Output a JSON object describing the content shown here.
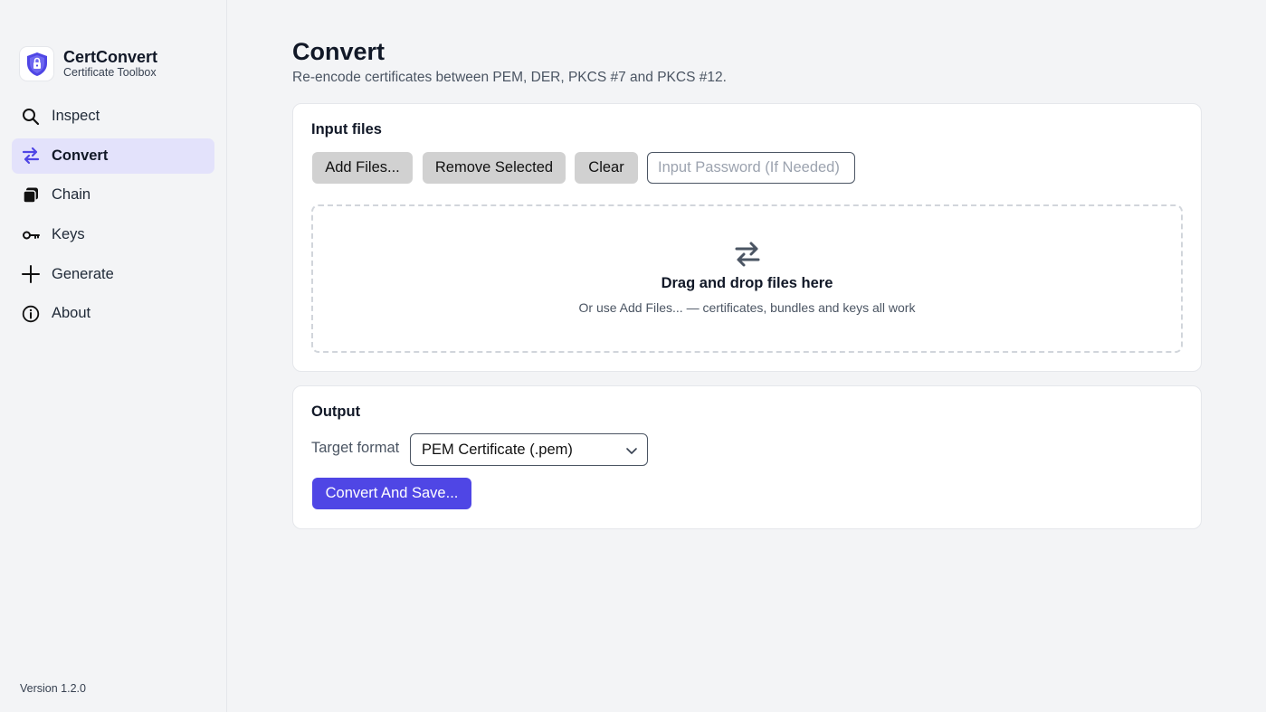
{
  "brand": {
    "name": "CertConvert",
    "subtitle": "Certificate Toolbox"
  },
  "sidebar": {
    "items": [
      {
        "label": "Inspect",
        "icon": "search-icon",
        "active": false
      },
      {
        "label": "Convert",
        "icon": "swap-arrows-icon",
        "active": true
      },
      {
        "label": "Chain",
        "icon": "stack-icon",
        "active": false
      },
      {
        "label": "Keys",
        "icon": "key-icon",
        "active": false
      },
      {
        "label": "Generate",
        "icon": "plus-icon",
        "active": false
      },
      {
        "label": "About",
        "icon": "info-icon",
        "active": false
      }
    ],
    "version": "Version 1.2.0"
  },
  "page": {
    "title": "Convert",
    "subtitle": "Re-encode certificates between PEM, DER, PKCS #7 and PKCS #12."
  },
  "input_card": {
    "title": "Input files",
    "buttons": {
      "add": "Add Files...",
      "remove": "Remove Selected",
      "clear": "Clear"
    },
    "password_placeholder": "Input Password (If Needed)",
    "dropzone": {
      "icon": "swap-arrows-icon",
      "title": "Drag and drop files here",
      "subtitle": "Or use Add Files... — certificates, bundles and keys all work"
    }
  },
  "output_card": {
    "title": "Output",
    "target_label": "Target format",
    "target_value": "PEM Certificate (.pem)",
    "convert_button": "Convert And Save..."
  },
  "colors": {
    "accent": "#4f46e5",
    "active_nav_bg": "#e3e2fb",
    "brand_shield": "#4f46e5"
  }
}
